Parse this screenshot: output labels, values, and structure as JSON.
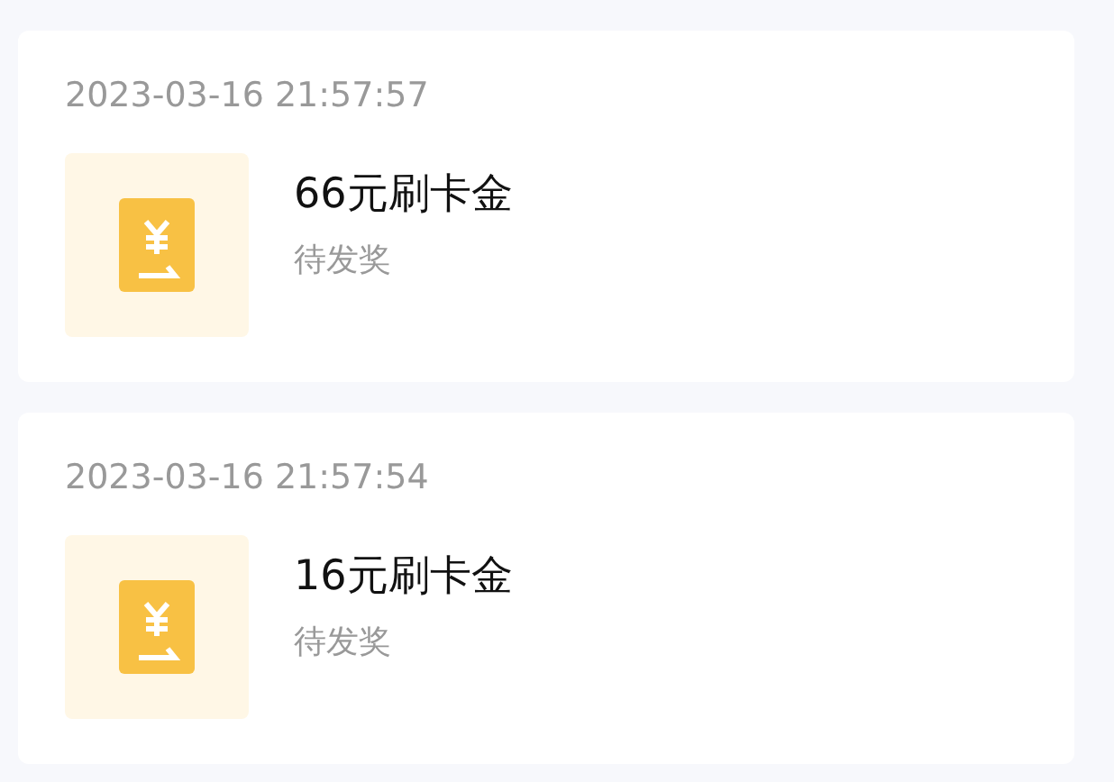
{
  "records": [
    {
      "time": "2023-03-16 21:57:57",
      "title": "66元刷卡金",
      "status": "待发奖"
    },
    {
      "time": "2023-03-16 21:57:54",
      "title": "16元刷卡金",
      "status": "待发奖"
    }
  ]
}
